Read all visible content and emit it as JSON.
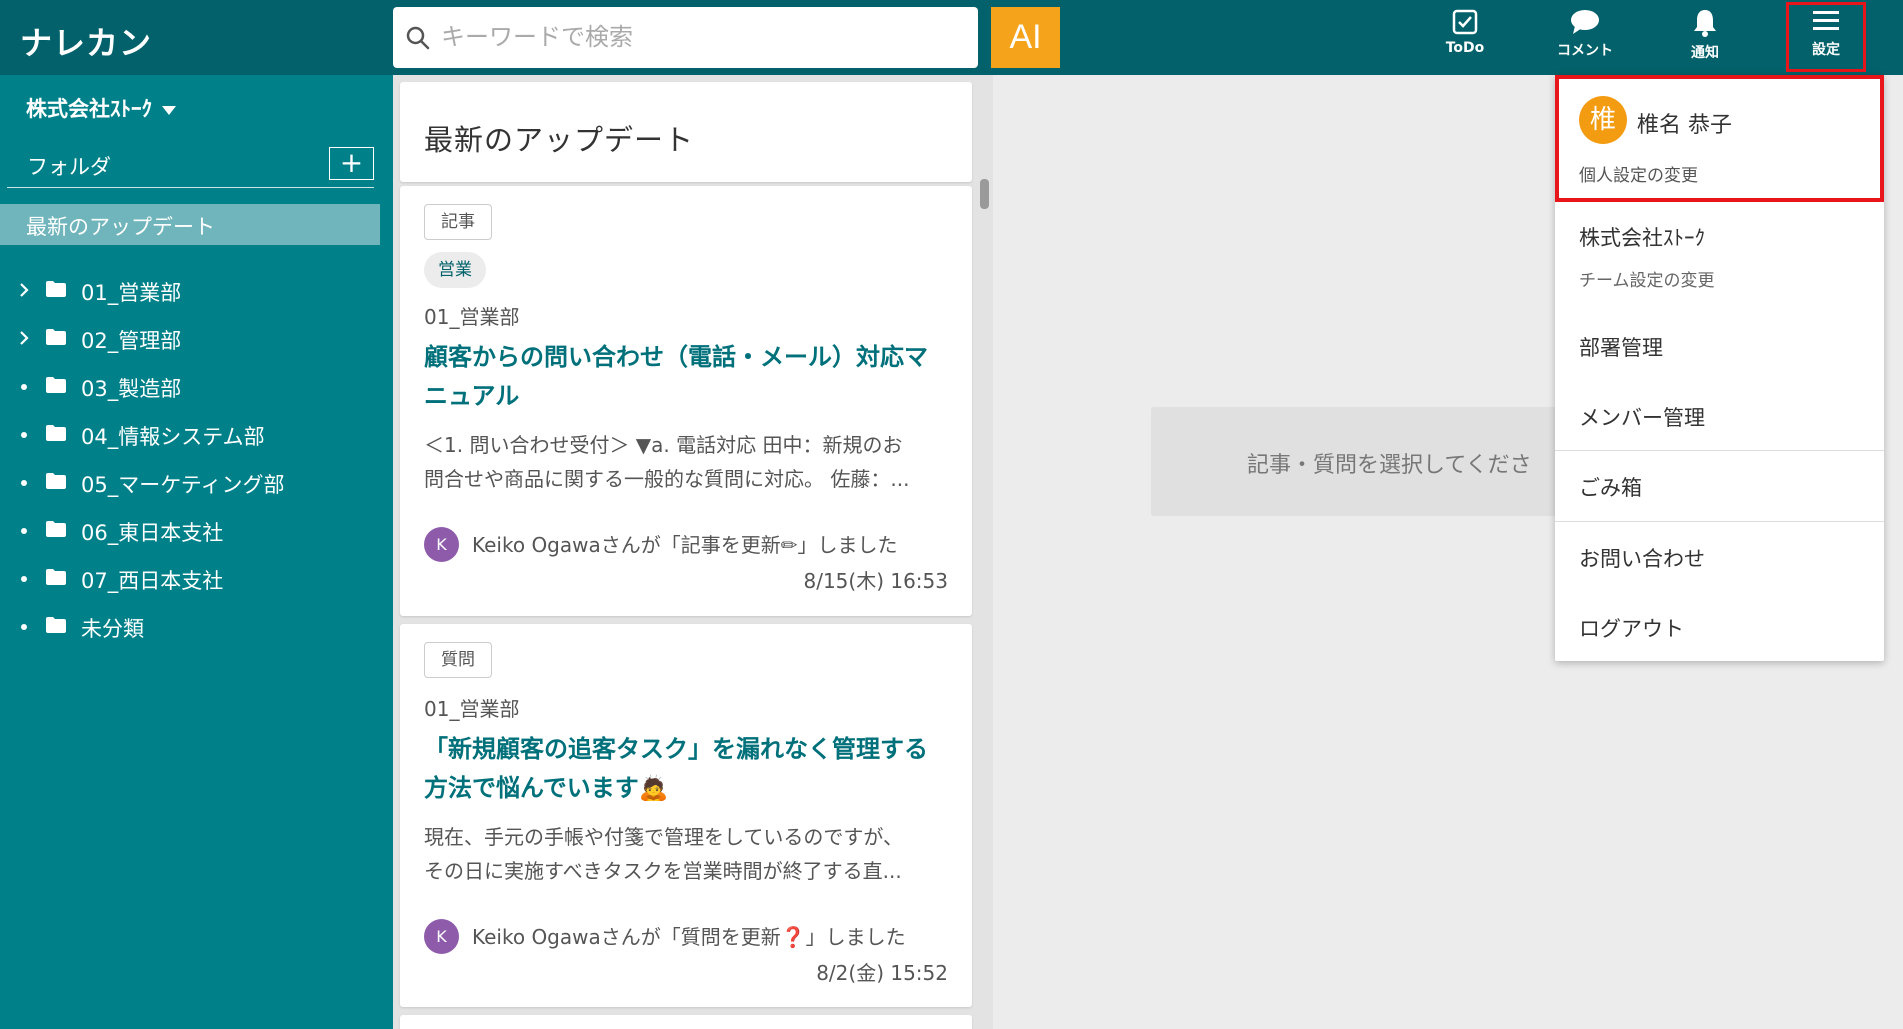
{
  "header": {
    "logo": "ナレカン",
    "search_placeholder": "キーワードで検索",
    "ai_label": "AI",
    "buttons": {
      "todo": "ToDo",
      "comment": "コメント",
      "notify": "通知",
      "settings": "設定"
    }
  },
  "sidebar": {
    "company": "株式会社ｽﾄｰｸ",
    "folder_label": "フォルダ",
    "add_label": "+",
    "latest": "最新のアップデート",
    "folders": [
      {
        "name": "01_営業部",
        "marker": "chevron"
      },
      {
        "name": "02_管理部",
        "marker": "chevron"
      },
      {
        "name": "03_製造部",
        "marker": "dot"
      },
      {
        "name": "04_情報システム部",
        "marker": "dot"
      },
      {
        "name": "05_マーケティング部",
        "marker": "dot"
      },
      {
        "name": "06_東日本支社",
        "marker": "dot"
      },
      {
        "name": "07_西日本支社",
        "marker": "dot"
      },
      {
        "name": "未分類",
        "marker": "dot"
      }
    ]
  },
  "feed": {
    "title": "最新のアップデート",
    "items": [
      {
        "type_tag": "記事",
        "category": "営業",
        "dept": "01_営業部",
        "title_line1": "顧客からの問い合わせ（電話・メール）対応マ",
        "title_line2": "ニュアル",
        "excerpt_line1": "＜1. 問い合わせ受付＞ ▼a. 電話対応 田中：新規のお",
        "excerpt_line2": "問合せや商品に関する一般的な質問に対応。 佐藤：...",
        "avatar": "K",
        "activity": "Keiko Ogawaさんが「記事を更新✏」しました",
        "date": "8/15(木) 16:53"
      },
      {
        "type_tag": "質問",
        "dept": "01_営業部",
        "title_line1": "「新規顧客の追客タスク」を漏れなく管理する",
        "title_line2": "方法で悩んでいます🙇",
        "excerpt_line1": "現在、手元の手帳や付箋で管理をしているのですが、",
        "excerpt_line2": "その日に実施すべきタスクを営業時間が終了する直...",
        "avatar": "K",
        "activity": "Keiko Ogawaさんが「質問を更新❓」しました",
        "date": "8/2(金) 15:52"
      }
    ]
  },
  "main": {
    "placeholder": "記事・質問を選択してくださ"
  },
  "menu": {
    "user_avatar": "椎",
    "user_name": "椎名 恭子",
    "user_settings": "個人設定の変更",
    "team_name": "株式会社ｽﾄｰｸ",
    "team_settings": "チーム設定の変更",
    "dept_mgmt": "部署管理",
    "member_mgmt": "メンバー管理",
    "trash": "ごみ箱",
    "contact": "お問い合わせ",
    "logout": "ログアウト"
  },
  "colors": {
    "header": "#02616a",
    "sidebar": "#00818a",
    "accent": "#f5a31a",
    "highlight": "#e8161b",
    "title_link": "#00707a"
  }
}
